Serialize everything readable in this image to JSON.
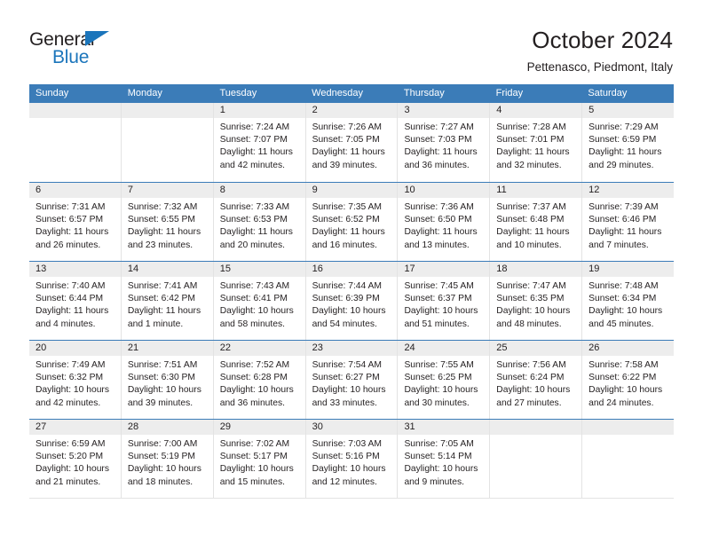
{
  "brand": {
    "name_part1": "General",
    "name_part2": "Blue",
    "accent_color": "#1b75bb"
  },
  "header": {
    "title": "October 2024",
    "subtitle": "Pettenasco, Piedmont, Italy"
  },
  "calendar": {
    "header_color": "#3b7cb8",
    "weekdays": [
      "Sunday",
      "Monday",
      "Tuesday",
      "Wednesday",
      "Thursday",
      "Friday",
      "Saturday"
    ],
    "weeks": [
      [
        {
          "day": "",
          "empty": true,
          "sunrise": "",
          "sunset": "",
          "daylight_1": "",
          "daylight_2": ""
        },
        {
          "day": "",
          "empty": true,
          "sunrise": "",
          "sunset": "",
          "daylight_1": "",
          "daylight_2": ""
        },
        {
          "day": "1",
          "empty": false,
          "sunrise": "Sunrise: 7:24 AM",
          "sunset": "Sunset: 7:07 PM",
          "daylight_1": "Daylight: 11 hours",
          "daylight_2": "and 42 minutes."
        },
        {
          "day": "2",
          "empty": false,
          "sunrise": "Sunrise: 7:26 AM",
          "sunset": "Sunset: 7:05 PM",
          "daylight_1": "Daylight: 11 hours",
          "daylight_2": "and 39 minutes."
        },
        {
          "day": "3",
          "empty": false,
          "sunrise": "Sunrise: 7:27 AM",
          "sunset": "Sunset: 7:03 PM",
          "daylight_1": "Daylight: 11 hours",
          "daylight_2": "and 36 minutes."
        },
        {
          "day": "4",
          "empty": false,
          "sunrise": "Sunrise: 7:28 AM",
          "sunset": "Sunset: 7:01 PM",
          "daylight_1": "Daylight: 11 hours",
          "daylight_2": "and 32 minutes."
        },
        {
          "day": "5",
          "empty": false,
          "sunrise": "Sunrise: 7:29 AM",
          "sunset": "Sunset: 6:59 PM",
          "daylight_1": "Daylight: 11 hours",
          "daylight_2": "and 29 minutes."
        }
      ],
      [
        {
          "day": "6",
          "empty": false,
          "sunrise": "Sunrise: 7:31 AM",
          "sunset": "Sunset: 6:57 PM",
          "daylight_1": "Daylight: 11 hours",
          "daylight_2": "and 26 minutes."
        },
        {
          "day": "7",
          "empty": false,
          "sunrise": "Sunrise: 7:32 AM",
          "sunset": "Sunset: 6:55 PM",
          "daylight_1": "Daylight: 11 hours",
          "daylight_2": "and 23 minutes."
        },
        {
          "day": "8",
          "empty": false,
          "sunrise": "Sunrise: 7:33 AM",
          "sunset": "Sunset: 6:53 PM",
          "daylight_1": "Daylight: 11 hours",
          "daylight_2": "and 20 minutes."
        },
        {
          "day": "9",
          "empty": false,
          "sunrise": "Sunrise: 7:35 AM",
          "sunset": "Sunset: 6:52 PM",
          "daylight_1": "Daylight: 11 hours",
          "daylight_2": "and 16 minutes."
        },
        {
          "day": "10",
          "empty": false,
          "sunrise": "Sunrise: 7:36 AM",
          "sunset": "Sunset: 6:50 PM",
          "daylight_1": "Daylight: 11 hours",
          "daylight_2": "and 13 minutes."
        },
        {
          "day": "11",
          "empty": false,
          "sunrise": "Sunrise: 7:37 AM",
          "sunset": "Sunset: 6:48 PM",
          "daylight_1": "Daylight: 11 hours",
          "daylight_2": "and 10 minutes."
        },
        {
          "day": "12",
          "empty": false,
          "sunrise": "Sunrise: 7:39 AM",
          "sunset": "Sunset: 6:46 PM",
          "daylight_1": "Daylight: 11 hours",
          "daylight_2": "and 7 minutes."
        }
      ],
      [
        {
          "day": "13",
          "empty": false,
          "sunrise": "Sunrise: 7:40 AM",
          "sunset": "Sunset: 6:44 PM",
          "daylight_1": "Daylight: 11 hours",
          "daylight_2": "and 4 minutes."
        },
        {
          "day": "14",
          "empty": false,
          "sunrise": "Sunrise: 7:41 AM",
          "sunset": "Sunset: 6:42 PM",
          "daylight_1": "Daylight: 11 hours",
          "daylight_2": "and 1 minute."
        },
        {
          "day": "15",
          "empty": false,
          "sunrise": "Sunrise: 7:43 AM",
          "sunset": "Sunset: 6:41 PM",
          "daylight_1": "Daylight: 10 hours",
          "daylight_2": "and 58 minutes."
        },
        {
          "day": "16",
          "empty": false,
          "sunrise": "Sunrise: 7:44 AM",
          "sunset": "Sunset: 6:39 PM",
          "daylight_1": "Daylight: 10 hours",
          "daylight_2": "and 54 minutes."
        },
        {
          "day": "17",
          "empty": false,
          "sunrise": "Sunrise: 7:45 AM",
          "sunset": "Sunset: 6:37 PM",
          "daylight_1": "Daylight: 10 hours",
          "daylight_2": "and 51 minutes."
        },
        {
          "day": "18",
          "empty": false,
          "sunrise": "Sunrise: 7:47 AM",
          "sunset": "Sunset: 6:35 PM",
          "daylight_1": "Daylight: 10 hours",
          "daylight_2": "and 48 minutes."
        },
        {
          "day": "19",
          "empty": false,
          "sunrise": "Sunrise: 7:48 AM",
          "sunset": "Sunset: 6:34 PM",
          "daylight_1": "Daylight: 10 hours",
          "daylight_2": "and 45 minutes."
        }
      ],
      [
        {
          "day": "20",
          "empty": false,
          "sunrise": "Sunrise: 7:49 AM",
          "sunset": "Sunset: 6:32 PM",
          "daylight_1": "Daylight: 10 hours",
          "daylight_2": "and 42 minutes."
        },
        {
          "day": "21",
          "empty": false,
          "sunrise": "Sunrise: 7:51 AM",
          "sunset": "Sunset: 6:30 PM",
          "daylight_1": "Daylight: 10 hours",
          "daylight_2": "and 39 minutes."
        },
        {
          "day": "22",
          "empty": false,
          "sunrise": "Sunrise: 7:52 AM",
          "sunset": "Sunset: 6:28 PM",
          "daylight_1": "Daylight: 10 hours",
          "daylight_2": "and 36 minutes."
        },
        {
          "day": "23",
          "empty": false,
          "sunrise": "Sunrise: 7:54 AM",
          "sunset": "Sunset: 6:27 PM",
          "daylight_1": "Daylight: 10 hours",
          "daylight_2": "and 33 minutes."
        },
        {
          "day": "24",
          "empty": false,
          "sunrise": "Sunrise: 7:55 AM",
          "sunset": "Sunset: 6:25 PM",
          "daylight_1": "Daylight: 10 hours",
          "daylight_2": "and 30 minutes."
        },
        {
          "day": "25",
          "empty": false,
          "sunrise": "Sunrise: 7:56 AM",
          "sunset": "Sunset: 6:24 PM",
          "daylight_1": "Daylight: 10 hours",
          "daylight_2": "and 27 minutes."
        },
        {
          "day": "26",
          "empty": false,
          "sunrise": "Sunrise: 7:58 AM",
          "sunset": "Sunset: 6:22 PM",
          "daylight_1": "Daylight: 10 hours",
          "daylight_2": "and 24 minutes."
        }
      ],
      [
        {
          "day": "27",
          "empty": false,
          "sunrise": "Sunrise: 6:59 AM",
          "sunset": "Sunset: 5:20 PM",
          "daylight_1": "Daylight: 10 hours",
          "daylight_2": "and 21 minutes."
        },
        {
          "day": "28",
          "empty": false,
          "sunrise": "Sunrise: 7:00 AM",
          "sunset": "Sunset: 5:19 PM",
          "daylight_1": "Daylight: 10 hours",
          "daylight_2": "and 18 minutes."
        },
        {
          "day": "29",
          "empty": false,
          "sunrise": "Sunrise: 7:02 AM",
          "sunset": "Sunset: 5:17 PM",
          "daylight_1": "Daylight: 10 hours",
          "daylight_2": "and 15 minutes."
        },
        {
          "day": "30",
          "empty": false,
          "sunrise": "Sunrise: 7:03 AM",
          "sunset": "Sunset: 5:16 PM",
          "daylight_1": "Daylight: 10 hours",
          "daylight_2": "and 12 minutes."
        },
        {
          "day": "31",
          "empty": false,
          "sunrise": "Sunrise: 7:05 AM",
          "sunset": "Sunset: 5:14 PM",
          "daylight_1": "Daylight: 10 hours",
          "daylight_2": "and 9 minutes."
        },
        {
          "day": "",
          "empty": true,
          "sunrise": "",
          "sunset": "",
          "daylight_1": "",
          "daylight_2": ""
        },
        {
          "day": "",
          "empty": true,
          "sunrise": "",
          "sunset": "",
          "daylight_1": "",
          "daylight_2": ""
        }
      ]
    ]
  }
}
